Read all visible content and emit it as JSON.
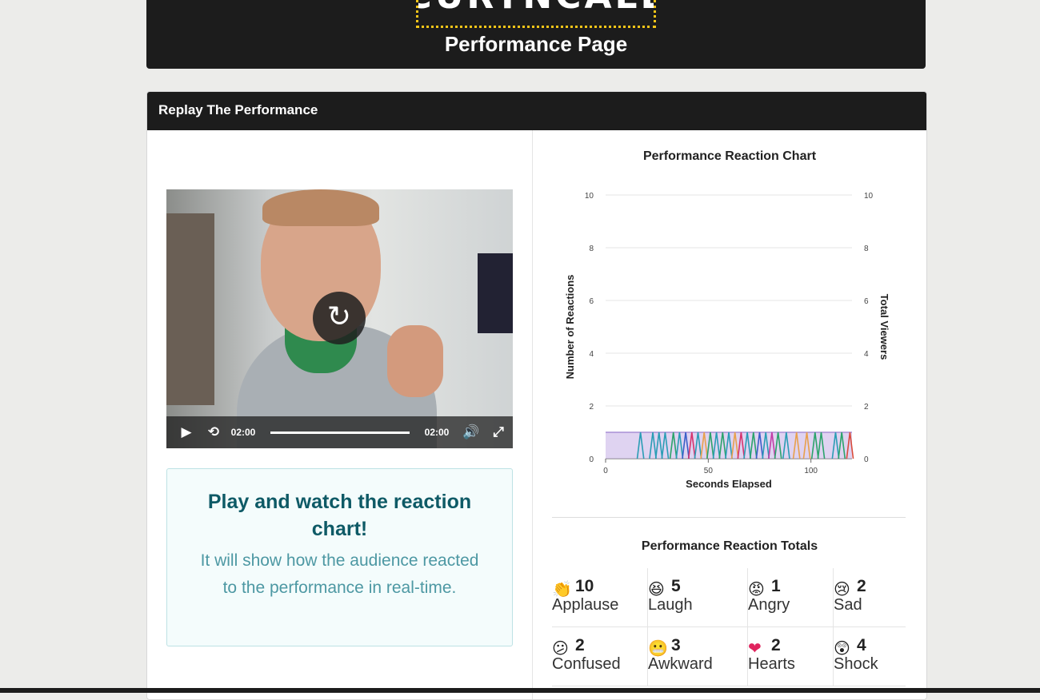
{
  "header": {
    "brand": "CURTNCALL",
    "title": "Performance Page"
  },
  "panel": {
    "title": "Replay The Performance"
  },
  "video": {
    "current_time": "02:00",
    "duration": "02:00",
    "progress": 1.0,
    "replay_icon": "replay-icon",
    "play_icon": "play-icon",
    "rewind_icon": "rewind-10-icon",
    "volume_icon": "volume-icon",
    "fullscreen_icon": "fullscreen-icon"
  },
  "info": {
    "title": "Play and watch the reaction chart!",
    "subtitle": "It will show how the audience reacted to the performance in real-time."
  },
  "chart_data": {
    "type": "line",
    "title": "Performance Reaction Chart",
    "xlabel": "Seconds Elapsed",
    "ylabel": "Number of Reactions",
    "ylabel_right": "Total Viewers",
    "xlim": [
      0,
      120
    ],
    "ylim": [
      0,
      10
    ],
    "x_ticks": [
      0,
      50,
      100
    ],
    "y_ticks": [
      0,
      2,
      4,
      6,
      8,
      10
    ],
    "grid": true,
    "viewers": {
      "color": "#c9b6e8",
      "line_color": "#a98fd6",
      "value": 1,
      "x_start": 0,
      "x_end": 120
    },
    "spikes": [
      {
        "x": 17,
        "color": "#2a9db5"
      },
      {
        "x": 23,
        "color": "#2a9db5"
      },
      {
        "x": 26,
        "color": "#2a9db5"
      },
      {
        "x": 29,
        "color": "#2a9db5"
      },
      {
        "x": 33,
        "color": "#2ba36b"
      },
      {
        "x": 36,
        "color": "#2a9db5"
      },
      {
        "x": 39,
        "color": "#3a5fc8"
      },
      {
        "x": 42,
        "color": "#d6336c"
      },
      {
        "x": 45,
        "color": "#2a9db5"
      },
      {
        "x": 48,
        "color": "#e8a04c"
      },
      {
        "x": 51,
        "color": "#2ba36b"
      },
      {
        "x": 54,
        "color": "#2a9db5"
      },
      {
        "x": 57,
        "color": "#2ba36b"
      },
      {
        "x": 60,
        "color": "#2a9db5"
      },
      {
        "x": 63,
        "color": "#e8a04c"
      },
      {
        "x": 66,
        "color": "#d6336c"
      },
      {
        "x": 69,
        "color": "#2a9db5"
      },
      {
        "x": 72,
        "color": "#2ba36b"
      },
      {
        "x": 75,
        "color": "#3a5fc8"
      },
      {
        "x": 78,
        "color": "#2a9db5"
      },
      {
        "x": 81,
        "color": "#c23ca6"
      },
      {
        "x": 84,
        "color": "#2ba36b"
      },
      {
        "x": 88,
        "color": "#2a9db5"
      },
      {
        "x": 93,
        "color": "#e8a04c"
      },
      {
        "x": 98,
        "color": "#e8a04c"
      },
      {
        "x": 102,
        "color": "#2ba36b"
      },
      {
        "x": 105,
        "color": "#2ba36b"
      },
      {
        "x": 112,
        "color": "#2a9db5"
      },
      {
        "x": 115,
        "color": "#2ba36b"
      },
      {
        "x": 119,
        "color": "#d94b3b"
      }
    ]
  },
  "totals": {
    "title": "Performance Reaction Totals",
    "items": [
      {
        "emoji": "👏",
        "icon": "clapping-hands-icon",
        "count": "10",
        "label": "Applause"
      },
      {
        "emoji": "😆",
        "icon": "laughing-face-icon",
        "count": "5",
        "label": "Laugh"
      },
      {
        "emoji": "😡",
        "icon": "angry-face-icon",
        "count": "1",
        "label": "Angry"
      },
      {
        "emoji": "😢",
        "icon": "crying-face-icon",
        "count": "2",
        "label": "Sad"
      },
      {
        "emoji": "😕",
        "icon": "confused-face-icon",
        "count": "2",
        "label": "Confused"
      },
      {
        "emoji": "😬",
        "icon": "grimacing-face-icon",
        "count": "3",
        "label": "Awkward"
      },
      {
        "emoji": "❤",
        "icon": "heart-icon",
        "count": "2",
        "label": "Hearts"
      },
      {
        "emoji": "😲",
        "icon": "astonished-face-icon",
        "count": "4",
        "label": "Shock"
      }
    ]
  }
}
